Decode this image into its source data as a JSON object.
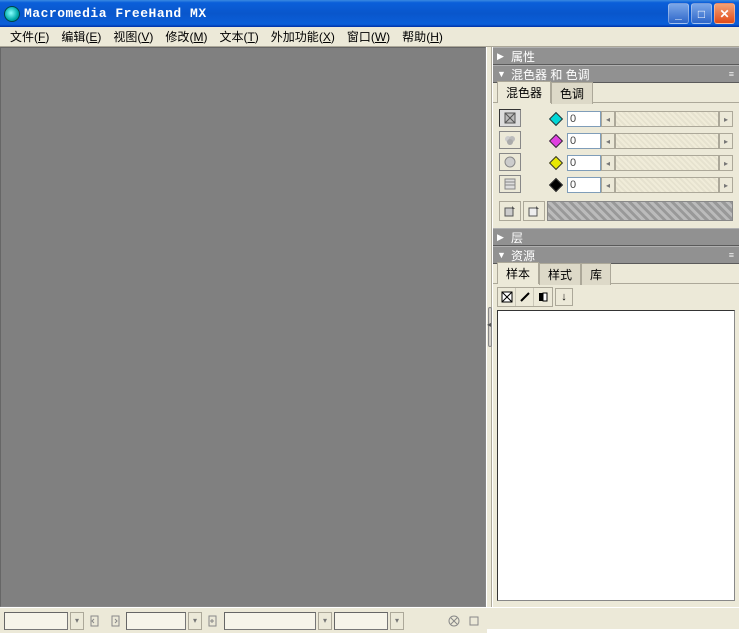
{
  "title": "Macromedia FreeHand MX",
  "menu": {
    "file": {
      "label": "文件",
      "hotkey": "F"
    },
    "edit": {
      "label": "编辑",
      "hotkey": "E"
    },
    "view": {
      "label": "视图",
      "hotkey": "V"
    },
    "modify": {
      "label": "修改",
      "hotkey": "M"
    },
    "text": {
      "label": "文本",
      "hotkey": "T"
    },
    "xtras": {
      "label": "外加功能",
      "hotkey": "X"
    },
    "window": {
      "label": "窗口",
      "hotkey": "W"
    },
    "help": {
      "label": "帮助",
      "hotkey": "H"
    }
  },
  "panels": {
    "properties": {
      "title": "属性",
      "expanded": false
    },
    "mixer": {
      "title": "混色器 和 色调",
      "expanded": true,
      "tabs": {
        "mixer": "混色器",
        "tints": "色调"
      },
      "channels": {
        "c": {
          "color": "#00d7d7",
          "value": "0"
        },
        "m": {
          "color": "#e040e0",
          "value": "0"
        },
        "y": {
          "color": "#e8e800",
          "value": "0"
        },
        "k": {
          "color": "#000000",
          "value": "0"
        }
      }
    },
    "layers": {
      "title": "层",
      "expanded": false
    },
    "assets": {
      "title": "资源",
      "expanded": true,
      "tabs": {
        "swatches": "样本",
        "styles": "样式",
        "library": "库"
      }
    }
  },
  "status": {
    "units_field": "",
    "page_field": ""
  }
}
